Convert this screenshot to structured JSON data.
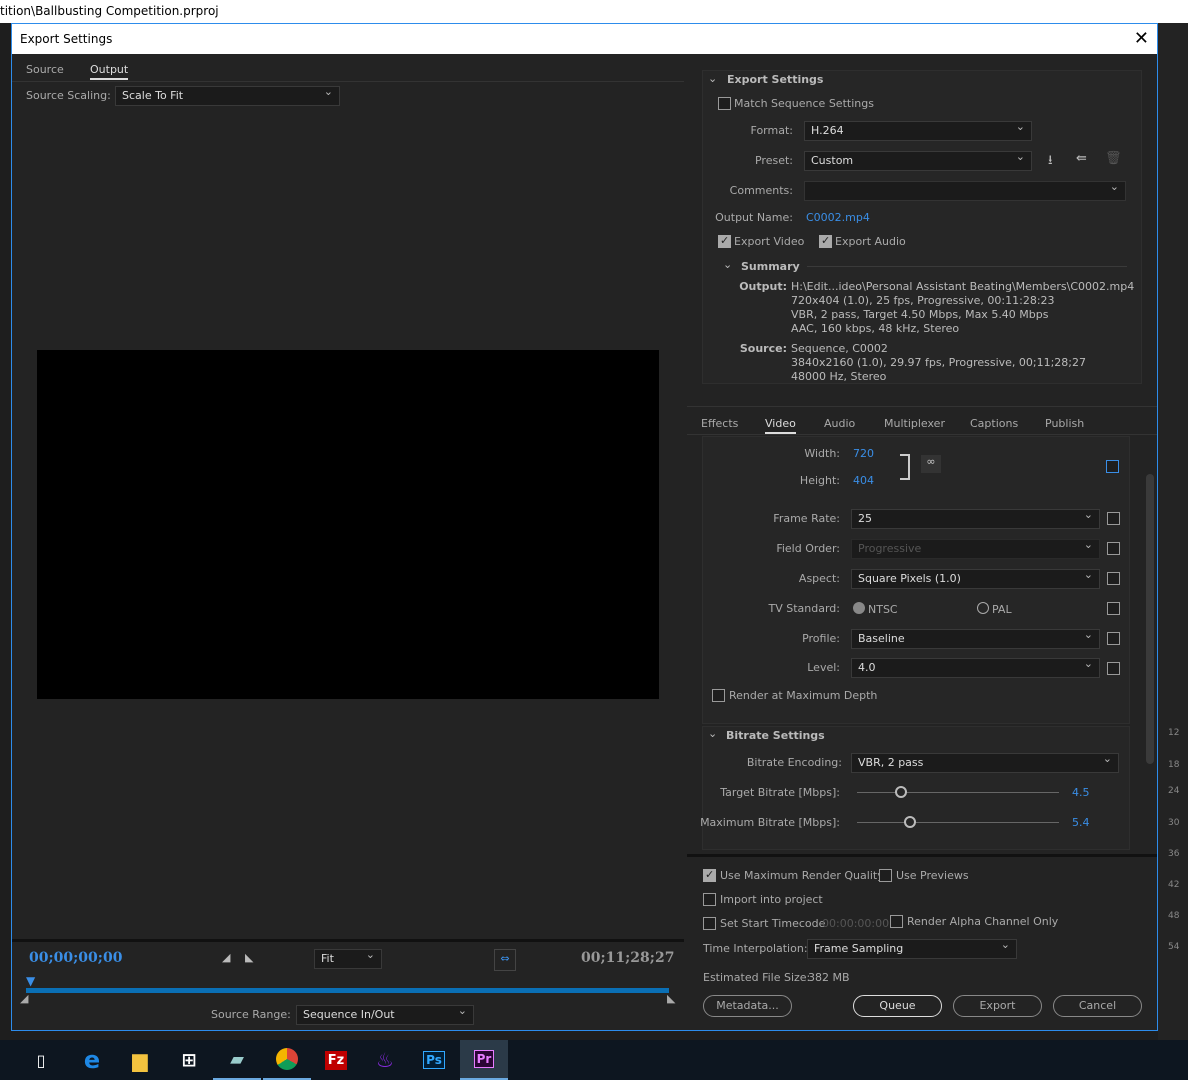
{
  "app_title": "tition\\Ballbusting Competition.prproj",
  "dialog": {
    "title": "Export Settings"
  },
  "left": {
    "tabs": [
      "Source",
      "Output"
    ],
    "source_scaling_label": "Source Scaling:",
    "source_scaling": "Scale To Fit",
    "timecode_start": "00;00;00;00",
    "timecode_end": "00;11;28;27",
    "zoom": "Fit",
    "source_range_label": "Source Range:",
    "source_range": "Sequence In/Out"
  },
  "export_settings": {
    "header": "Export Settings",
    "match_sequence": "Match Sequence Settings",
    "format_label": "Format:",
    "format": "H.264",
    "preset_label": "Preset:",
    "preset": "Custom",
    "comments_label": "Comments:",
    "comments": "",
    "output_name_label": "Output Name:",
    "output_name": "C0002.mp4",
    "export_video": "Export Video",
    "export_audio": "Export Audio",
    "summary_header": "Summary",
    "output_label": "Output:",
    "output_lines": [
      "H:\\Edit...ideo\\Personal Assistant Beating\\Members\\C0002.mp4",
      "720x404 (1.0), 25 fps, Progressive, 00:11:28:23",
      "VBR, 2 pass, Target 4.50 Mbps, Max 5.40 Mbps",
      "AAC, 160 kbps, 48 kHz, Stereo"
    ],
    "source_label": "Source:",
    "source_lines": [
      "Sequence, C0002",
      "3840x2160 (1.0), 29.97 fps, Progressive, 00;11;28;27",
      "48000 Hz, Stereo"
    ]
  },
  "tabs": [
    "Effects",
    "Video",
    "Audio",
    "Multiplexer",
    "Captions",
    "Publish"
  ],
  "video": {
    "width_label": "Width:",
    "width": "720",
    "height_label": "Height:",
    "height": "404",
    "frame_rate_label": "Frame Rate:",
    "frame_rate": "25",
    "field_order_label": "Field Order:",
    "field_order": "Progressive",
    "aspect_label": "Aspect:",
    "aspect": "Square Pixels (1.0)",
    "tv_label": "TV Standard:",
    "ntsc": "NTSC",
    "pal": "PAL",
    "profile_label": "Profile:",
    "profile": "Baseline",
    "level_label": "Level:",
    "level": "4.0",
    "max_depth": "Render at Maximum Depth"
  },
  "bitrate": {
    "header": "Bitrate Settings",
    "encoding_label": "Bitrate Encoding:",
    "encoding": "VBR, 2 pass",
    "target_label": "Target Bitrate [Mbps]:",
    "target": "4.5",
    "max_label": "Maximum Bitrate [Mbps]:",
    "max": "5.4"
  },
  "bottom": {
    "max_quality": "Use Maximum Render Quality",
    "use_previews": "Use Previews",
    "import": "Import into project",
    "start_tc": "Set Start Timecode",
    "start_tc_value": "00:00:00:00",
    "alpha": "Render Alpha Channel Only",
    "interp_label": "Time Interpolation:",
    "interp": "Frame Sampling",
    "file_size_label": "Estimated File Size:",
    "file_size": "382 MB",
    "metadata": "Metadata...",
    "queue": "Queue",
    "export": "Export",
    "cancel": "Cancel"
  },
  "bg_numbers": [
    "12",
    "18",
    "24",
    "30",
    "36",
    "42",
    "48",
    "54"
  ],
  "taskbar": [
    "task-view",
    "edge",
    "file-explorer",
    "store",
    "notepad",
    "chrome",
    "filezilla",
    "app",
    "photoshop",
    "premiere"
  ],
  "colors": {
    "accent": "#3a8ee6",
    "bg": "#232323",
    "timeline": "#0a6fb5"
  }
}
